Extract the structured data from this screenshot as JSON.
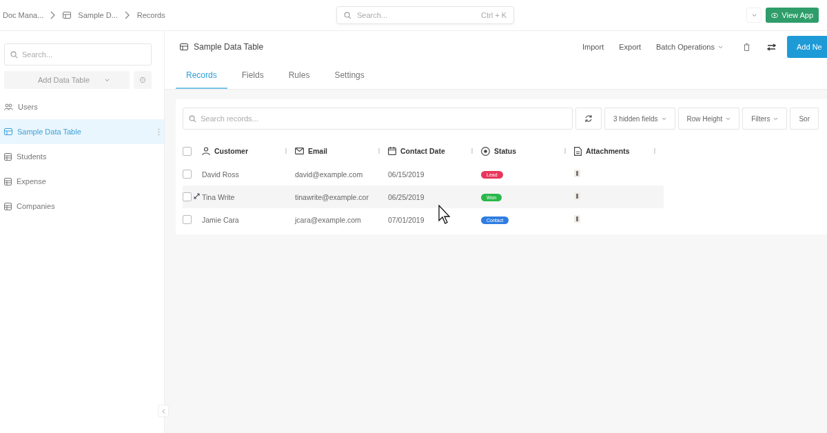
{
  "breadcrumb": [
    "Doc Mana...",
    "Sample D...",
    "Records"
  ],
  "global_search": {
    "placeholder": "Search...",
    "shortcut": "Ctrl + K"
  },
  "view_app_button": "View App",
  "sidebar": {
    "search": {
      "placeholder": "Search..."
    },
    "add_button": "Add Data Table",
    "items": [
      {
        "label": "Users",
        "kind": "users",
        "selected": false
      },
      {
        "label": "Sample Data Table",
        "kind": "table",
        "selected": true
      },
      {
        "label": "Students",
        "kind": "sheet",
        "selected": false
      },
      {
        "label": "Expense",
        "kind": "sheet",
        "selected": false
      },
      {
        "label": "Companies",
        "kind": "sheet",
        "selected": false
      }
    ]
  },
  "table_title": "Sample Data Table",
  "actions": [
    "Import",
    "Export",
    "Batch Operations"
  ],
  "add_new_button": "Add Ne",
  "tabs": [
    {
      "label": "Records",
      "selected": true
    },
    {
      "label": "Fields",
      "selected": false
    },
    {
      "label": "Rules",
      "selected": false
    },
    {
      "label": "Settings",
      "selected": false
    }
  ],
  "toolbar": {
    "search": {
      "placeholder": "Search records..."
    },
    "buttons": [
      "3 hidden fields",
      "Row Height",
      "Filters",
      "Sor"
    ]
  },
  "table": {
    "select_all_checked": false,
    "columns": [
      {
        "label": "Customer",
        "kind": "person"
      },
      {
        "label": "Email",
        "kind": "mail"
      },
      {
        "label": "Contact Date",
        "kind": "calendar"
      },
      {
        "label": "Status",
        "kind": "status"
      },
      {
        "label": "Attachments",
        "kind": "file"
      }
    ],
    "rows": [
      {
        "customer": "David Ross",
        "email": "david@example.com",
        "date": "06/15/2019",
        "status": "Lead",
        "color": "#e8365d",
        "checked": false,
        "hovered": false
      },
      {
        "customer": "Tina Write",
        "email": "tinawrite@example.cor",
        "date": "06/25/2019",
        "status": "Won",
        "color": "#2bb84b",
        "checked": false,
        "hovered": true
      },
      {
        "customer": "Jamie Cara",
        "email": "jcara@example.com",
        "date": "07/01/2019",
        "status": "Contact",
        "color": "#2f7de1",
        "checked": false,
        "hovered": false
      }
    ]
  }
}
